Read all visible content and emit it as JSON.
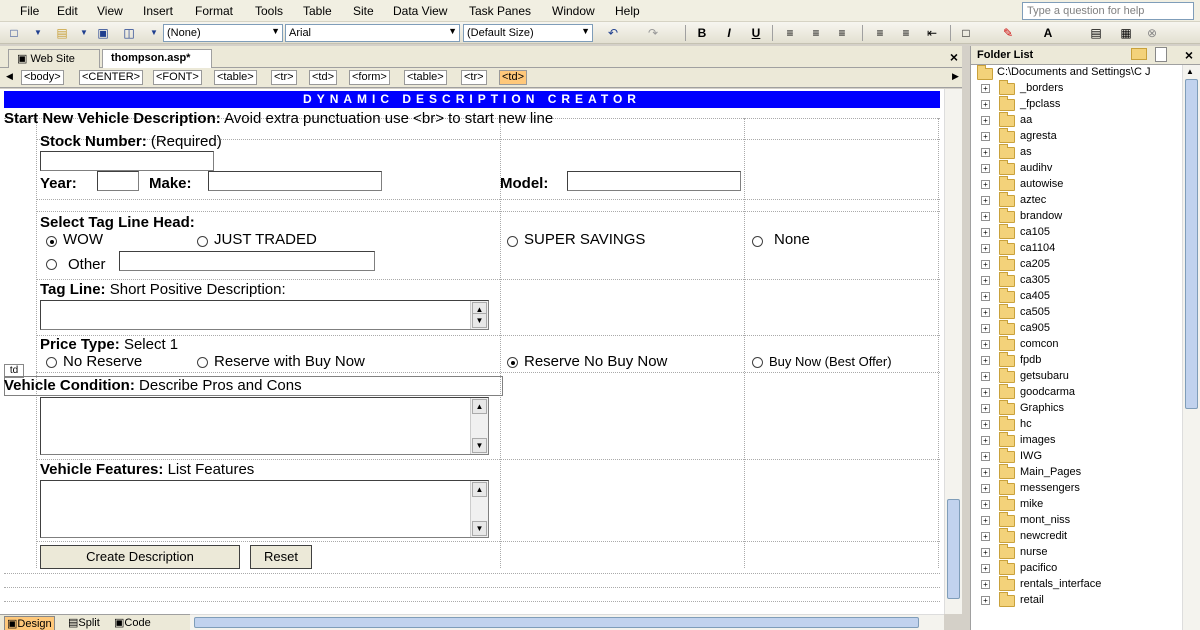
{
  "menu": [
    "File",
    "Edit",
    "View",
    "Insert",
    "Format",
    "Tools",
    "Table",
    "Site",
    "Data View",
    "Task Panes",
    "Window",
    "Help"
  ],
  "help_placeholder": "Type a question for help",
  "toolbar": {
    "style": "(None)",
    "font": "Arial",
    "size": "(Default Size)",
    "bold": "B",
    "italic": "I",
    "underline": "U"
  },
  "doc_tabs": [
    "Web Site",
    "thompson.asp*"
  ],
  "tag_path": [
    "<body>",
    "<CENTER>",
    "<FONT>",
    "<table>",
    "<tr>",
    "<td>",
    "<form>",
    "<table>",
    "<tr>",
    "<td>"
  ],
  "form": {
    "banner": "DYNAMIC DESCRIPTION CREATOR",
    "start_label": "Start New Vehicle Description:",
    "start_hint": "Avoid extra punctuation use <br> to start new line",
    "stock_label": "Stock Number:",
    "stock_hint": "(Required)",
    "year_label": "Year:",
    "make_label": "Make:",
    "model_label": "Model:",
    "tag_head_label": "Select Tag Line Head:",
    "tag_heads": [
      "WOW",
      "JUST TRADED",
      "SUPER SAVINGS",
      "None",
      "Other"
    ],
    "tag_line_label": "Tag Line:",
    "tag_line_hint": "Short Positive Description:",
    "price_label": "Price Type:",
    "price_hint": "Select 1",
    "price_types": [
      "No Reserve",
      "Reserve with Buy Now",
      "Reserve No Buy Now",
      "Buy Now (Best Offer)"
    ],
    "condition_label": "Vehicle Condition:",
    "condition_hint": "Describe Pros and Cons",
    "features_label": "Vehicle Features:",
    "features_hint": "List Features",
    "create_button": "Create Description",
    "reset_button": "Reset",
    "td_marker": "td"
  },
  "modes": [
    "Design",
    "Split",
    "Code"
  ],
  "folder_list": {
    "title": "Folder List",
    "root": "C:\\Documents and Settings\\C J",
    "folders": [
      "_borders",
      "_fpclass",
      "aa",
      "agresta",
      "as",
      "audihv",
      "autowise",
      "aztec",
      "brandow",
      "ca105",
      "ca1104",
      "ca205",
      "ca305",
      "ca405",
      "ca505",
      "ca905",
      "comcon",
      "fpdb",
      "getsubaru",
      "goodcarma",
      "Graphics",
      "hc",
      "images",
      "IWG",
      "Main_Pages",
      "messengers",
      "mike",
      "mont_niss",
      "newcredit",
      "nurse",
      "pacifico",
      "rentals_interface",
      "retail"
    ]
  }
}
